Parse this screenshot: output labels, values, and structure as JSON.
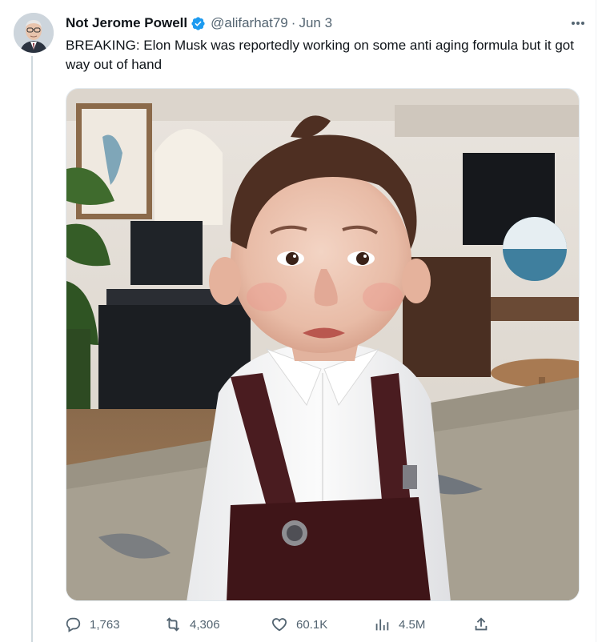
{
  "tweet": {
    "author_name": "Not Jerome Powell",
    "handle": "@alifarhat79",
    "separator": "·",
    "date": "Jun 3",
    "text": "BREAKING: Elon Musk was reportedly working on some anti aging formula but it got way out of hand",
    "verified": true
  },
  "actions": {
    "replies": "1,763",
    "retweets": "4,306",
    "likes": "60.1K",
    "views": "4.5M"
  },
  "icons": {
    "verified": "verified-badge-icon",
    "more": "more-options-icon",
    "reply": "reply-icon",
    "retweet": "retweet-icon",
    "like": "heart-icon",
    "views": "views-chart-icon",
    "share": "share-icon"
  },
  "colors": {
    "verified_blue": "#1d9bf0",
    "text_primary": "#0f1419",
    "text_secondary": "#536471"
  }
}
